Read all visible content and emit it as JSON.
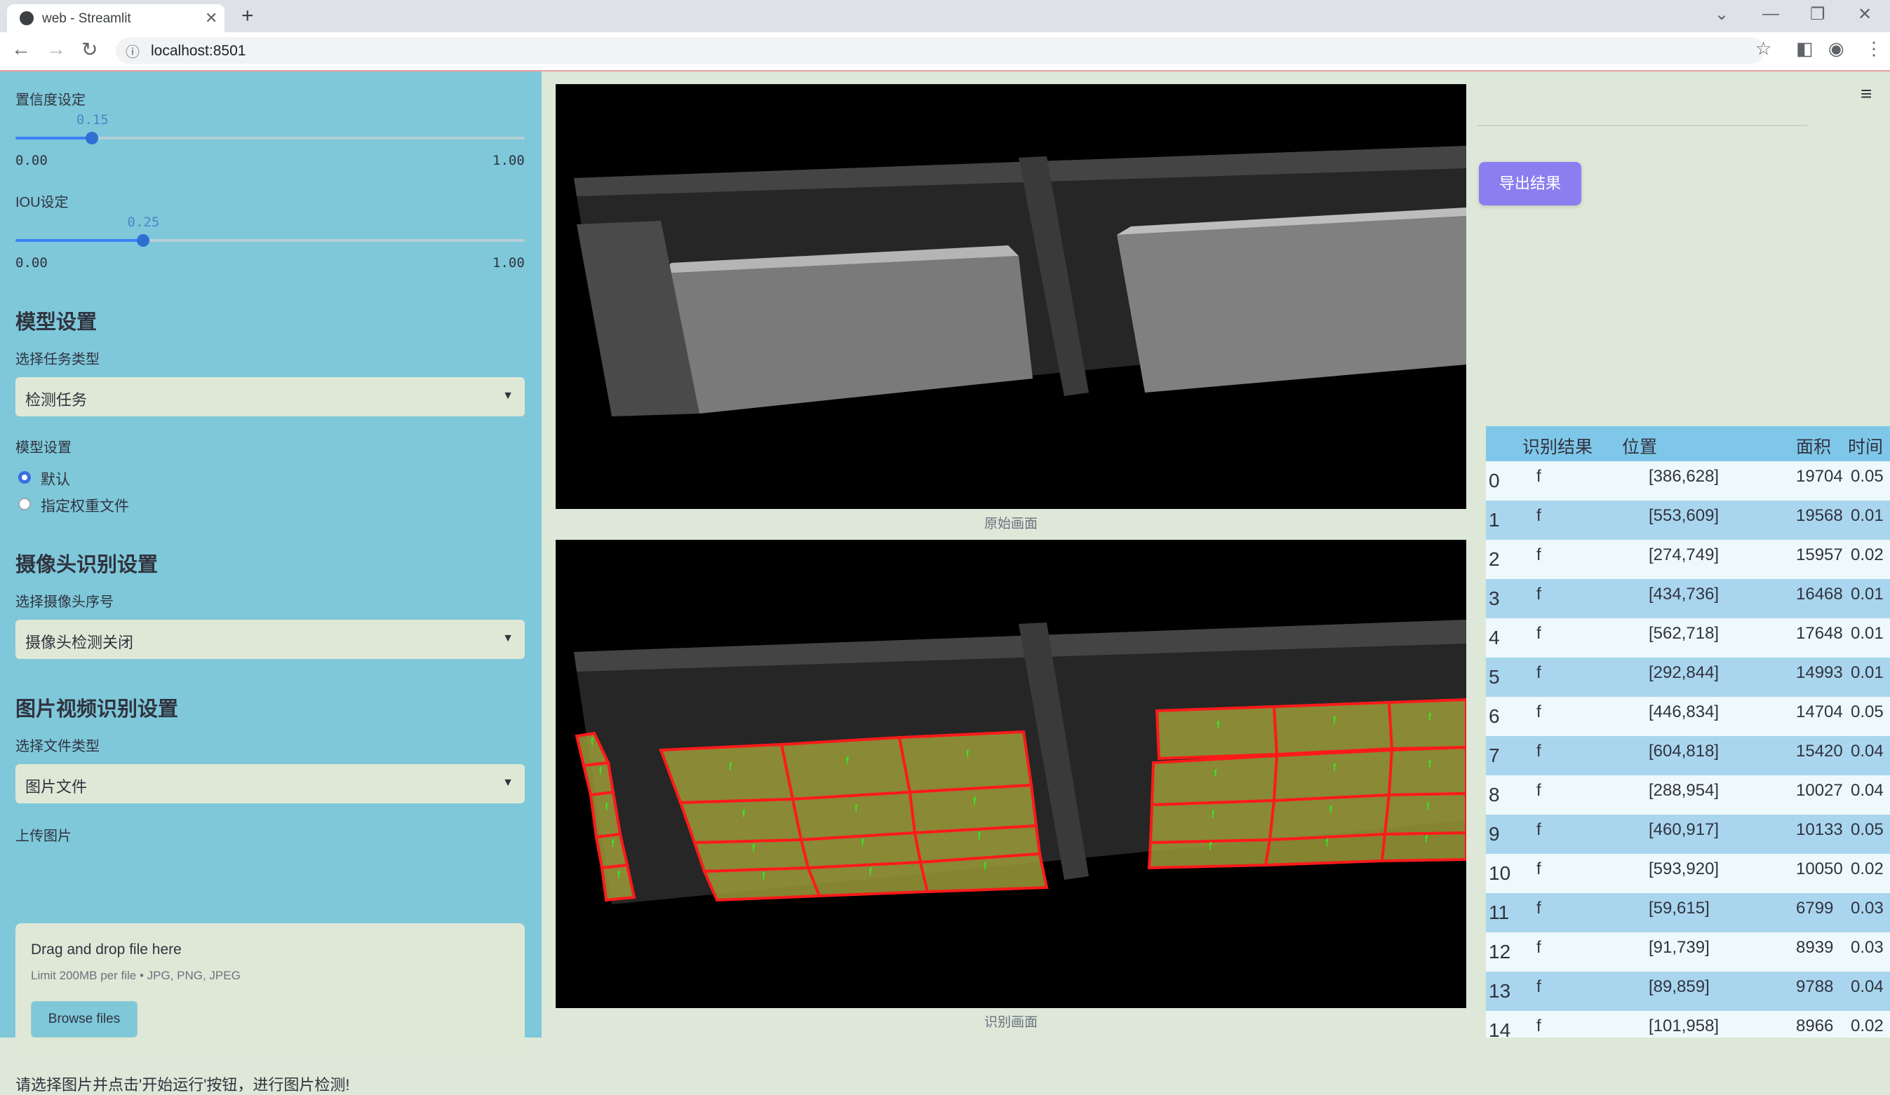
{
  "browser": {
    "tab_title": "web - Streamlit",
    "url": "localhost:8501"
  },
  "sidebar": {
    "confidence": {
      "label": "置信度设定",
      "value": "0.15",
      "min": "0.00",
      "max": "1.00",
      "fraction": 0.15
    },
    "iou": {
      "label": "IOU设定",
      "value": "0.25",
      "min": "0.00",
      "max": "1.00",
      "fraction": 0.25
    },
    "model_heading": "模型设置",
    "task_label": "选择任务类型",
    "task_value": "检测任务",
    "model_label": "模型设置",
    "model_options": [
      "默认",
      "指定权重文件"
    ],
    "model_selected": 0,
    "camera_heading": "摄像头识别设置",
    "camera_label": "选择摄像头序号",
    "camera_value": "摄像头检测关闭",
    "media_heading": "图片视频识别设置",
    "filetype_label": "选择文件类型",
    "filetype_value": "图片文件",
    "upload_label": "上传图片",
    "drop_title": "Drag and drop file here",
    "drop_limit": "Limit 200MB per file • JPG, PNG, JPEG",
    "browse_label": "Browse files",
    "hint": "请选择图片并点击'开始运行'按钮，进行图片检测!"
  },
  "main": {
    "original_caption": "原始画面",
    "result_caption": "识别画面",
    "export_label": "导出结果",
    "detection_label": "f"
  },
  "table": {
    "columns": [
      "识别结果",
      "位置",
      "面积",
      "时间"
    ],
    "rows": [
      {
        "idx": "0",
        "result": "f",
        "pos": "[386,628]",
        "area": "19704",
        "time": "0.05"
      },
      {
        "idx": "1",
        "result": "f",
        "pos": "[553,609]",
        "area": "19568",
        "time": "0.01"
      },
      {
        "idx": "2",
        "result": "f",
        "pos": "[274,749]",
        "area": "15957",
        "time": "0.02"
      },
      {
        "idx": "3",
        "result": "f",
        "pos": "[434,736]",
        "area": "16468",
        "time": "0.01"
      },
      {
        "idx": "4",
        "result": "f",
        "pos": "[562,718]",
        "area": "17648",
        "time": "0.01"
      },
      {
        "idx": "5",
        "result": "f",
        "pos": "[292,844]",
        "area": "14993",
        "time": "0.01"
      },
      {
        "idx": "6",
        "result": "f",
        "pos": "[446,834]",
        "area": "14704",
        "time": "0.05"
      },
      {
        "idx": "7",
        "result": "f",
        "pos": "[604,818]",
        "area": "15420",
        "time": "0.04"
      },
      {
        "idx": "8",
        "result": "f",
        "pos": "[288,954]",
        "area": "10027",
        "time": "0.04"
      },
      {
        "idx": "9",
        "result": "f",
        "pos": "[460,917]",
        "area": "10133",
        "time": "0.05"
      },
      {
        "idx": "10",
        "result": "f",
        "pos": "[593,920]",
        "area": "10050",
        "time": "0.02"
      },
      {
        "idx": "11",
        "result": "f",
        "pos": "[59,615]",
        "area": "6799",
        "time": "0.03"
      },
      {
        "idx": "12",
        "result": "f",
        "pos": "[91,739]",
        "area": "8939",
        "time": "0.03"
      },
      {
        "idx": "13",
        "result": "f",
        "pos": "[89,859]",
        "area": "9788",
        "time": "0.04"
      },
      {
        "idx": "14",
        "result": "f",
        "pos": "[101,958]",
        "area": "8966",
        "time": "0.02"
      }
    ]
  },
  "colors": {
    "sidebar_bg": "#7ec8da",
    "main_bg": "#dde8d8",
    "accent": "#8c7ef0",
    "box_stroke": "#ff1a1a",
    "box_fill": "#9b9b3a",
    "label_color": "#22ff22"
  }
}
